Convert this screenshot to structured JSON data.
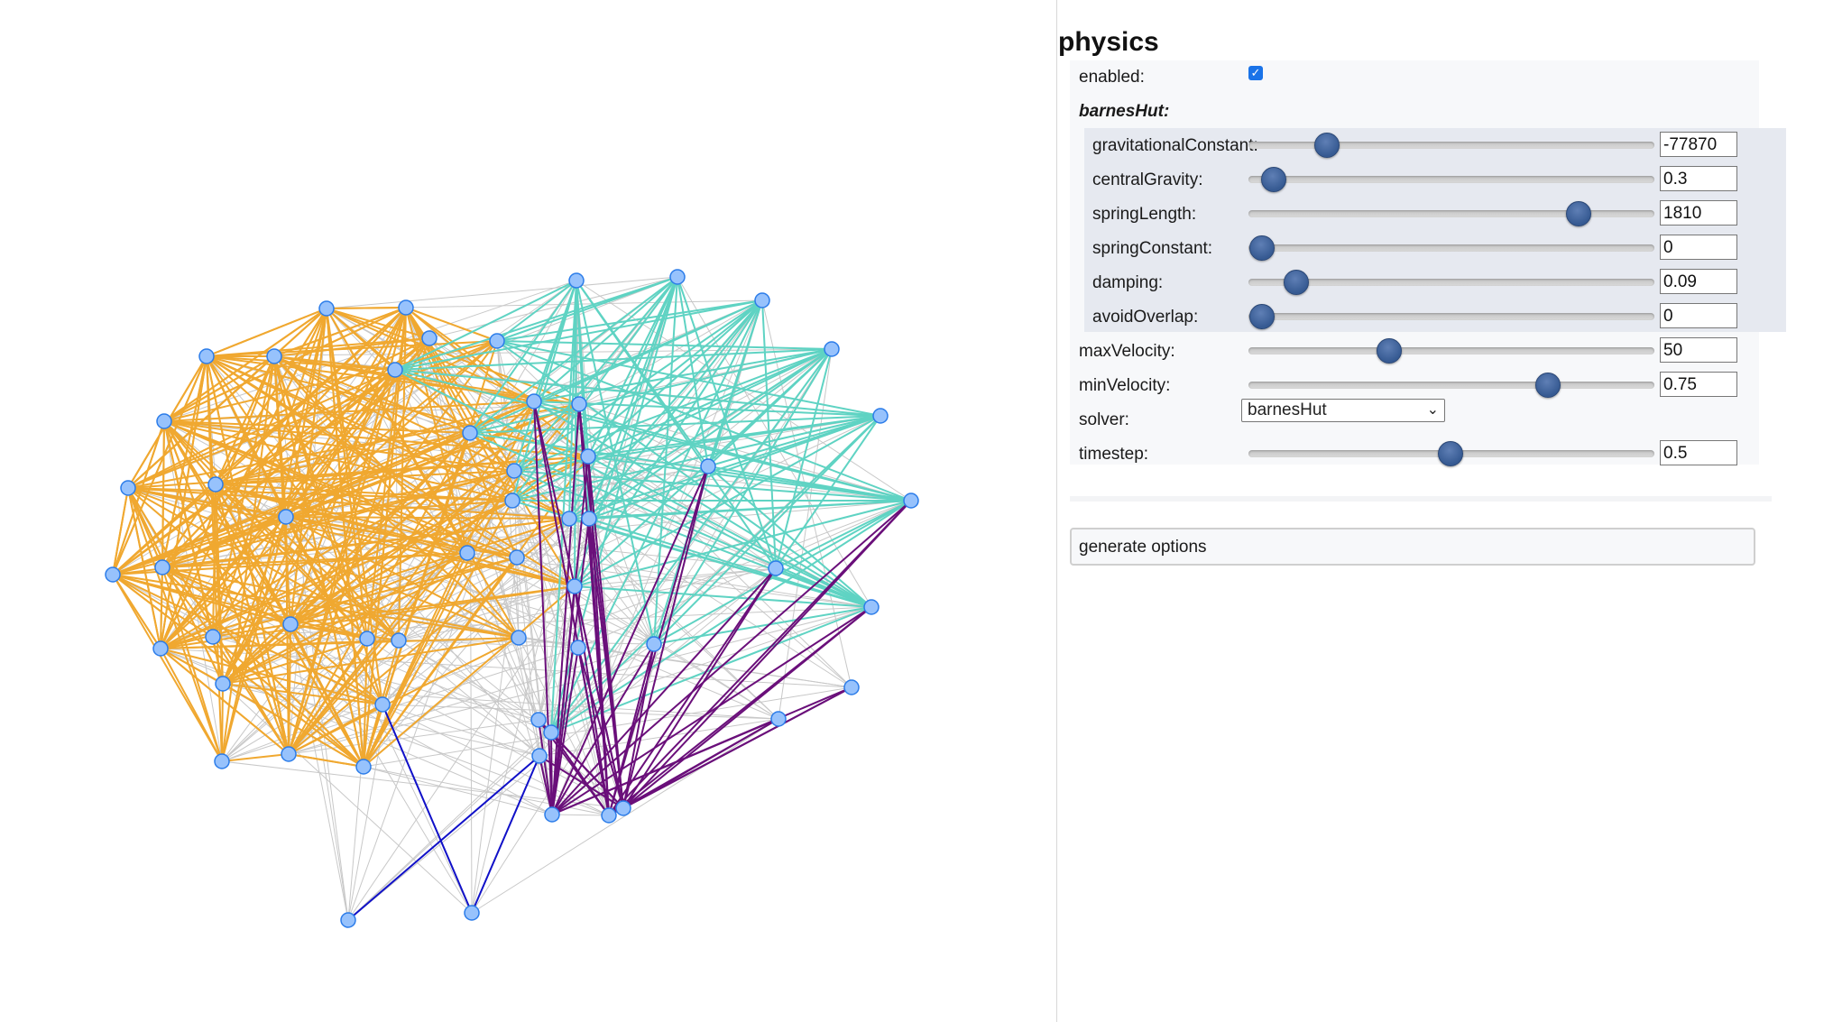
{
  "network": {
    "node_color": "#97c2fc",
    "node_border": "#2b7ce9",
    "edge_default_color": "#c8c8c8",
    "group_colors": {
      "orange": "#f0a830",
      "teal": "#5fd3c3",
      "purple": "#6a0f7a",
      "blue": "#1010c8"
    }
  },
  "config": {
    "title": "physics",
    "enabled_label": "enabled:",
    "enabled_checked": true,
    "solver_section_label": "barnesHut:",
    "rows": [
      {
        "label": "gravitationalConstant:",
        "value": "-77870",
        "position": 0.19
      },
      {
        "label": "centralGravity:",
        "value": "0.3",
        "position": 0.06
      },
      {
        "label": "springLength:",
        "value": "1810",
        "position": 0.81
      },
      {
        "label": "springConstant:",
        "value": "0",
        "position": 0.03
      },
      {
        "label": "damping:",
        "value": "0.09",
        "position": 0.115
      },
      {
        "label": "avoidOverlap:",
        "value": "0",
        "position": 0.03
      }
    ],
    "general_rows": [
      {
        "label": "maxVelocity:",
        "value": "50",
        "position": 0.345
      },
      {
        "label": "minVelocity:",
        "value": "0.75",
        "position": 0.735
      }
    ],
    "solver_label": "solver:",
    "solver_value": "barnesHut",
    "timestep_label": "timestep:",
    "timestep_value": "0.5",
    "timestep_position": 0.495,
    "generate_button_label": "generate options"
  }
}
